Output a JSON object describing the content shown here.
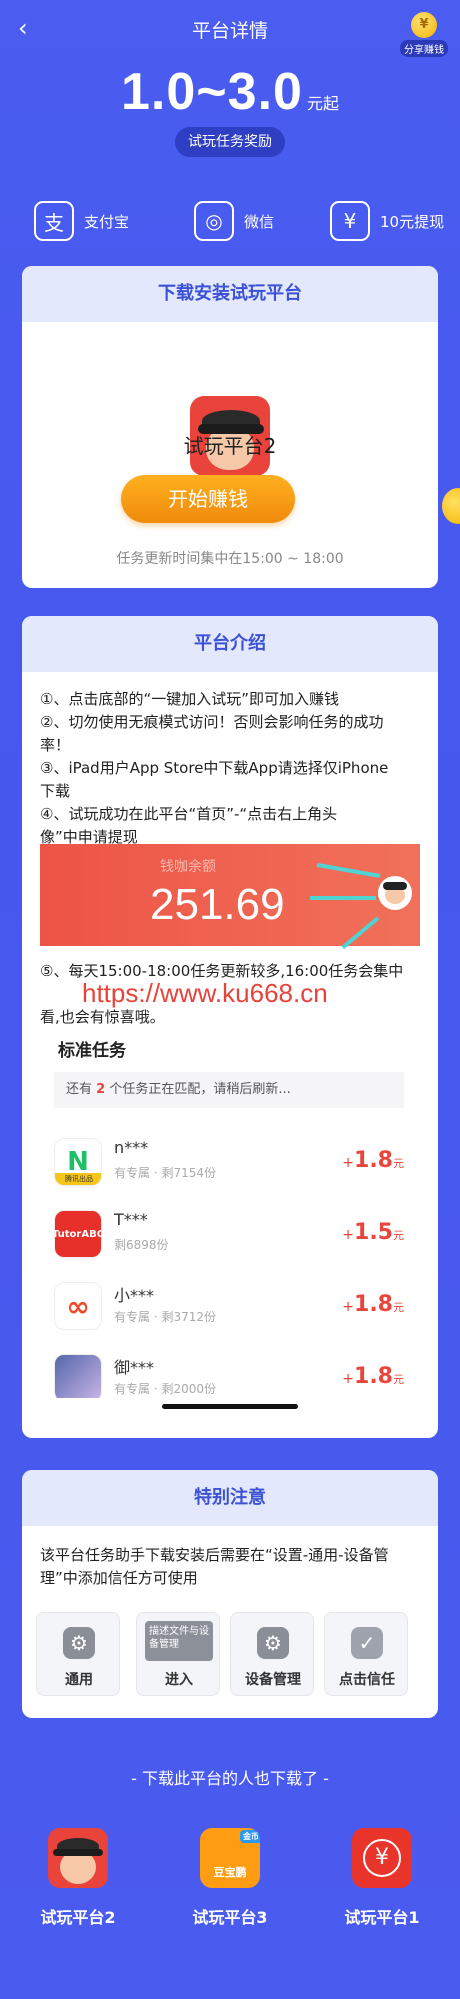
{
  "header": {
    "back_icon": "chevron-left-icon",
    "title": "平台详情",
    "share_icon": "yen-coin-icon",
    "share_coin_glyph": "¥",
    "share_label": "分享赚钱"
  },
  "reward": {
    "range": "1.0~3.0",
    "unit": "元起",
    "badge": "试玩任务奖励"
  },
  "payouts": [
    {
      "icon": "alipay-icon",
      "glyph": "支",
      "label": "支付宝"
    },
    {
      "icon": "wechat-icon",
      "glyph": "◎",
      "label": "微信"
    },
    {
      "icon": "yen-icon",
      "glyph": "¥",
      "label": "10元提现"
    }
  ],
  "download_card": {
    "title": "下载安装试玩平台",
    "app_name": "试玩平台2",
    "button": "开始赚钱",
    "schedule": "任务更新时间集中在15:00 ~ 18:00"
  },
  "intro_card": {
    "title": "平台介绍",
    "step1": "①、点击底部的“一键加入试玩”即可加入赚钱",
    "step2a": "②、切勿使用无痕模式访问！否则会影响任务的成功",
    "step2b": "率！",
    "step3a": "③、iPad用户App Store中下载App请选择仅iPhone",
    "step3b": "下载",
    "step4a": "④、试玩成功在此平台“首页”-“点击右上角头",
    "step4b": "像”中申请提现",
    "balance_label": "钱咖余额",
    "balance_value": "251.69",
    "step5a": "⑤、每天15:00-18:00任务更新较多,16:00任务会集中",
    "step5b": "看,也会有惊喜哦。",
    "watermark": "https://www.ku668.cn",
    "task_section_title": "标准任务",
    "notice_prefix": "还有",
    "notice_count": "2",
    "notice_suffix": "个任务正在匹配，请稍后刷新...",
    "tasks": [
      {
        "name": "n***",
        "meta": "有专属 · 剩7154份",
        "plus": "+",
        "amount": "1.8",
        "unit": "元",
        "icon_glyph": "N",
        "icon_badge": "腾讯出品"
      },
      {
        "name": "T***",
        "meta": "剩6898份",
        "plus": "+",
        "amount": "1.5",
        "unit": "元",
        "icon_glyph": "TutorABC"
      },
      {
        "name": "小***",
        "meta": "有专属 · 剩3712份",
        "plus": "+",
        "amount": "1.8",
        "unit": "元",
        "icon_glyph": "∞"
      },
      {
        "name": "御***",
        "meta": "有专属 · 剩2000份",
        "plus": "+",
        "amount": "1.8",
        "unit": "元",
        "icon_glyph": ""
      }
    ]
  },
  "notice_card": {
    "title": "特别注意",
    "text_a": "该平台任务助手下载安装后需要在“设置-通用-设备管",
    "text_b": "理”中添加信任方可使用",
    "steps": [
      {
        "icon": "settings-gear-icon",
        "glyph": "⚙",
        "label": "通用"
      },
      {
        "icon": "describe-file-icon",
        "glyph": "描述文件与设备管理",
        "label": "进入"
      },
      {
        "icon": "device-management-icon",
        "glyph": "⚙",
        "label": "设备管理"
      },
      {
        "icon": "checkmark-icon",
        "glyph": "✓",
        "label": "点击信任"
      }
    ]
  },
  "also_downloaded": {
    "title": "- 下载此平台的人也下载了 -",
    "apps": [
      {
        "name": "试玩平台2",
        "icon": "hat-face-icon"
      },
      {
        "name": "试玩平台3",
        "icon": "piggy-bank-icon",
        "glyph": "豆宝鹏",
        "badge": "金币"
      },
      {
        "name": "试玩平台1",
        "icon": "yen-shield-icon",
        "glyph": "¥"
      }
    ]
  }
}
